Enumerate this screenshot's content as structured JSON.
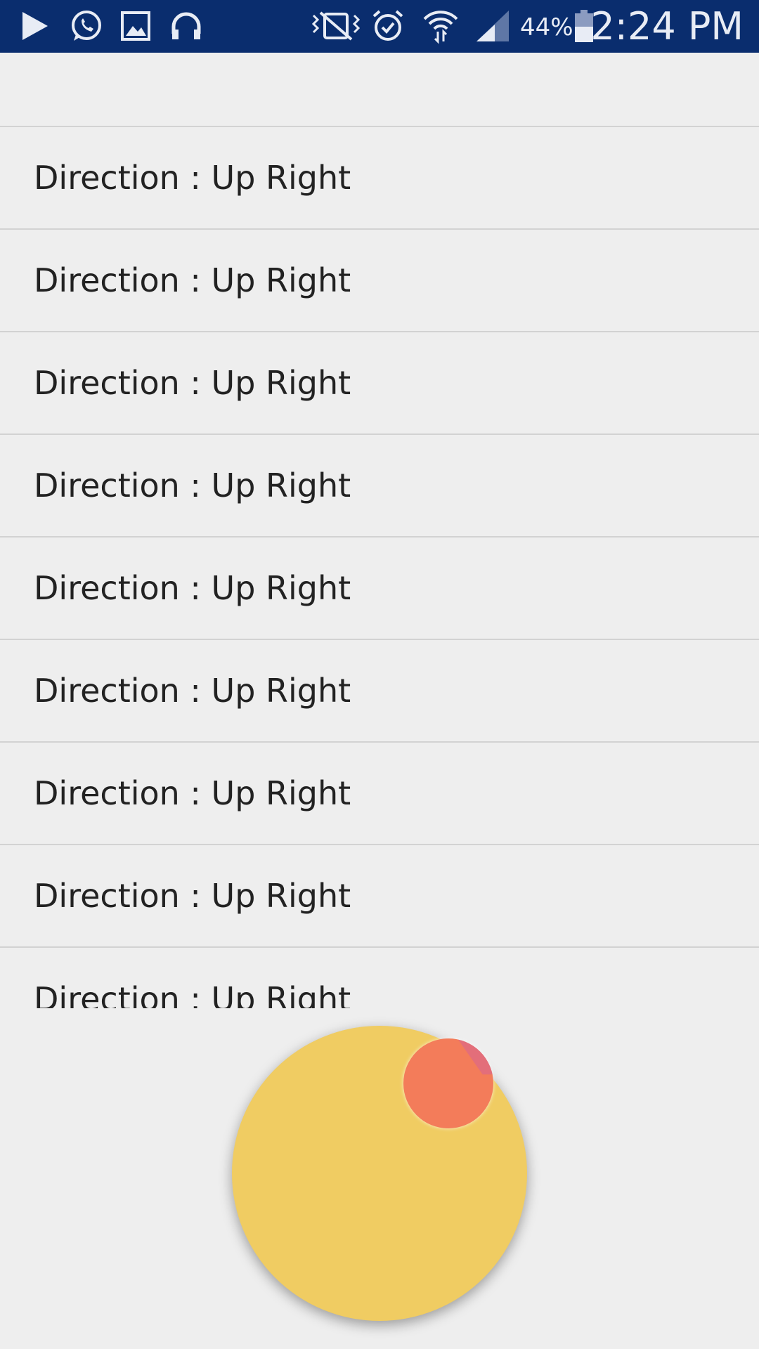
{
  "status_bar": {
    "background": "#0a2d6e",
    "left_icons": [
      "play-store-icon",
      "whatsapp-icon",
      "gallery-icon",
      "headphones-icon"
    ],
    "right_icons": [
      "vibrate-mute-icon",
      "alarm-icon",
      "wifi-icon",
      "cell-signal-icon",
      "battery-icon"
    ],
    "battery_percent": "44%",
    "time": "2:24 PM"
  },
  "list": {
    "items": [
      {
        "label": "Direction : Up Right"
      },
      {
        "label": "Direction : Up Right"
      },
      {
        "label": "Direction : Up Right"
      },
      {
        "label": "Direction : Up Right"
      },
      {
        "label": "Direction : Up Right"
      },
      {
        "label": "Direction : Up Right"
      },
      {
        "label": "Direction : Up Right"
      },
      {
        "label": "Direction : Up Right"
      },
      {
        "label": "Direction : Up Right"
      }
    ]
  },
  "joystick": {
    "base_color": "#f0cc62",
    "thumb_color": "#f37c5a",
    "direction": "up-right"
  }
}
